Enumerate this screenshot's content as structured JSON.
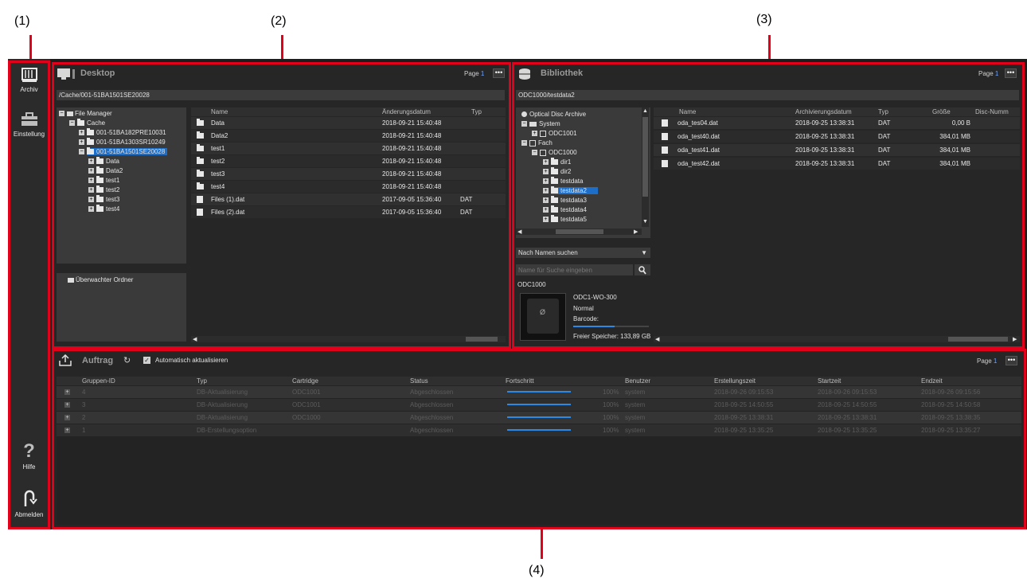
{
  "callouts": {
    "c1": "(1)",
    "c2": "(2)",
    "c3": "(3)",
    "c4": "(4)"
  },
  "sidebar": {
    "archiv": "Archiv",
    "einstellung": "Einstellung",
    "hilfe": "Hilfe",
    "abmelden": "Abmelden"
  },
  "desktop": {
    "title": "Desktop",
    "page_label": "Page",
    "page_num": "1",
    "more": "•••",
    "path": "/Cache/001-51BA1501SE20028",
    "tree": [
      {
        "pm": "−",
        "label": "File Manager"
      },
      {
        "pm": "−",
        "label": "Cache"
      },
      {
        "pm": "+",
        "label": "001-51BA182PRE10031"
      },
      {
        "pm": "+",
        "label": "001-51BA1303SR10249"
      },
      {
        "pm": "−",
        "label": "001-51BA1501SE20028"
      },
      {
        "pm": "+",
        "label": "Data"
      },
      {
        "pm": "+",
        "label": "Data2"
      },
      {
        "pm": "+",
        "label": "test1"
      },
      {
        "pm": "+",
        "label": "test2"
      },
      {
        "pm": "+",
        "label": "test3"
      },
      {
        "pm": "+",
        "label": "test4"
      }
    ],
    "watched": "Überwachter Ordner",
    "columns": {
      "name": "Name",
      "date": "Änderungsdatum",
      "type": "Typ"
    },
    "rows": [
      {
        "name": "Data",
        "date": "2018-09-21 15:40:48",
        "type": ""
      },
      {
        "name": "Data2",
        "date": "2018-09-21 15:40:48",
        "type": ""
      },
      {
        "name": "test1",
        "date": "2018-09-21 15:40:48",
        "type": ""
      },
      {
        "name": "test2",
        "date": "2018-09-21 15:40:48",
        "type": ""
      },
      {
        "name": "test3",
        "date": "2018-09-21 15:40:48",
        "type": ""
      },
      {
        "name": "test4",
        "date": "2018-09-21 15:40:48",
        "type": ""
      },
      {
        "name": "Files (1).dat",
        "date": "2017-09-05 15:36:40",
        "type": "DAT"
      },
      {
        "name": "Files (2).dat",
        "date": "2017-09-05 15:36:40",
        "type": "DAT"
      }
    ]
  },
  "bibliothek": {
    "title": "Bibliothek",
    "page_label": "Page",
    "page_num": "1",
    "more": "•••",
    "path": "ODC1000/testdata2",
    "tree": [
      {
        "label": "Optical Disc Archive"
      },
      {
        "label": "System"
      },
      {
        "label": "ODC1001"
      },
      {
        "label": "Fach"
      },
      {
        "label": "ODC1000"
      },
      {
        "label": "dir1"
      },
      {
        "label": "dir2"
      },
      {
        "label": "testdata"
      },
      {
        "label": "testdata2"
      },
      {
        "label": "testdata3"
      },
      {
        "label": "testdata4"
      },
      {
        "label": "testdata5"
      }
    ],
    "search_mode": "Nach Namen suchen",
    "search_placeholder": "Name für Suche eingeben",
    "cartridge": {
      "id": "ODC1000",
      "model": "ODC1-WO-300",
      "state": "Normal",
      "barcode": "Barcode:",
      "free": "Freier Speicher: 133,89 GB",
      "fill": 0.55
    },
    "columns": {
      "name": "Name",
      "date": "Archivierungsdatum",
      "type": "Typ",
      "size": "Größe",
      "disc": "Disc-Numm"
    },
    "rows": [
      {
        "name": "oda_tes04.dat",
        "date": "2018-09-25 13:38:31",
        "type": "DAT",
        "size": "0,00 B"
      },
      {
        "name": "oda_test40.dat",
        "date": "2018-09-25 13:38:31",
        "type": "DAT",
        "size": "384,01 MB"
      },
      {
        "name": "oda_test41.dat",
        "date": "2018-09-25 13:38:31",
        "type": "DAT",
        "size": "384,01 MB"
      },
      {
        "name": "oda_test42.dat",
        "date": "2018-09-25 13:38:31",
        "type": "DAT",
        "size": "384,01 MB"
      }
    ]
  },
  "auftrag": {
    "title": "Auftrag",
    "auto_refresh": "Automatisch aktualisieren",
    "page_label": "Page",
    "page_num": "1",
    "more": "•••",
    "columns": {
      "gid": "Gruppen-ID",
      "type": "Typ",
      "cart": "Cartridge",
      "status": "Status",
      "progress": "Fortschritt",
      "user": "Benutzer",
      "created": "Erstellungszeit",
      "start": "Startzeit",
      "end": "Endzeit"
    },
    "rows": [
      {
        "gid": "4",
        "type": "DB-Aktualisierung",
        "cart": "ODC1001",
        "status": "Abgeschlossen",
        "progress": 1.0,
        "pct": "100%",
        "user": "system",
        "created": "2018-09-26 09:15:53",
        "start": "2018-09-26 09:15:53",
        "end": "2018-09-26 09:15:56"
      },
      {
        "gid": "3",
        "type": "DB-Aktualisierung",
        "cart": "ODC1001",
        "status": "Abgeschlossen",
        "progress": 1.0,
        "pct": "100%",
        "user": "system",
        "created": "2018-09-25 14:50:55",
        "start": "2018-09-25 14:50:55",
        "end": "2018-09-25 14:50:58"
      },
      {
        "gid": "2",
        "type": "DB-Aktualisierung",
        "cart": "ODC1000",
        "status": "Abgeschlossen",
        "progress": 1.0,
        "pct": "100%",
        "user": "system",
        "created": "2018-09-25 13:38:31",
        "start": "2018-09-25 13:38:31",
        "end": "2018-09-25 13:38:35"
      },
      {
        "gid": "1",
        "type": "DB-Erstellungsoption",
        "cart": "",
        "status": "Abgeschlossen",
        "progress": 1.0,
        "pct": "100%",
        "user": "system",
        "created": "2018-09-25 13:35:25",
        "start": "2018-09-25 13:35:25",
        "end": "2018-09-25 13:35:27"
      }
    ]
  }
}
